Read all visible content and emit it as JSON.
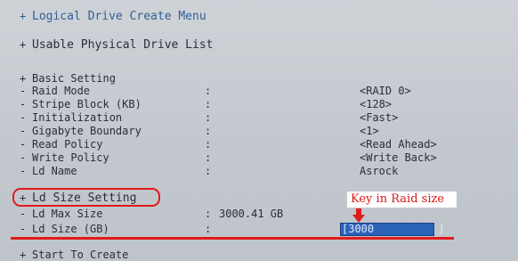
{
  "menu": {
    "title": "Logical Drive Create Menu",
    "physical_list": "Usable Physical Drive List",
    "basic_setting": "Basic Setting",
    "items": [
      {
        "label": "Raid Mode",
        "value": "<RAID 0>"
      },
      {
        "label": "Stripe Block (KB)",
        "value": "<128>"
      },
      {
        "label": "Initialization",
        "value": "<Fast>"
      },
      {
        "label": "Gigabyte Boundary",
        "value": "<1>"
      },
      {
        "label": "Read Policy",
        "value": "<Read Ahead>"
      },
      {
        "label": "Write Policy",
        "value": "<Write Back>"
      },
      {
        "label": "Ld Name",
        "value": "Asrock"
      }
    ],
    "ld_size_setting": "Ld Size Setting",
    "ld_max_size": {
      "label": "Ld Max Size",
      "value": "3000.41 GB"
    },
    "ld_size": {
      "label": "Ld Size (GB)",
      "value": "[3000          ]"
    },
    "start": "Start To Create",
    "colon": ":",
    "plus": "+",
    "dash": "-"
  },
  "annotation": {
    "text": "Key in Raid size",
    "color": "#d61919"
  },
  "colors": {
    "input_bg": "#2b63b9",
    "text": "#2c2c38",
    "menu_blue": "#2f5f95",
    "highlight": "#e01b1b"
  }
}
